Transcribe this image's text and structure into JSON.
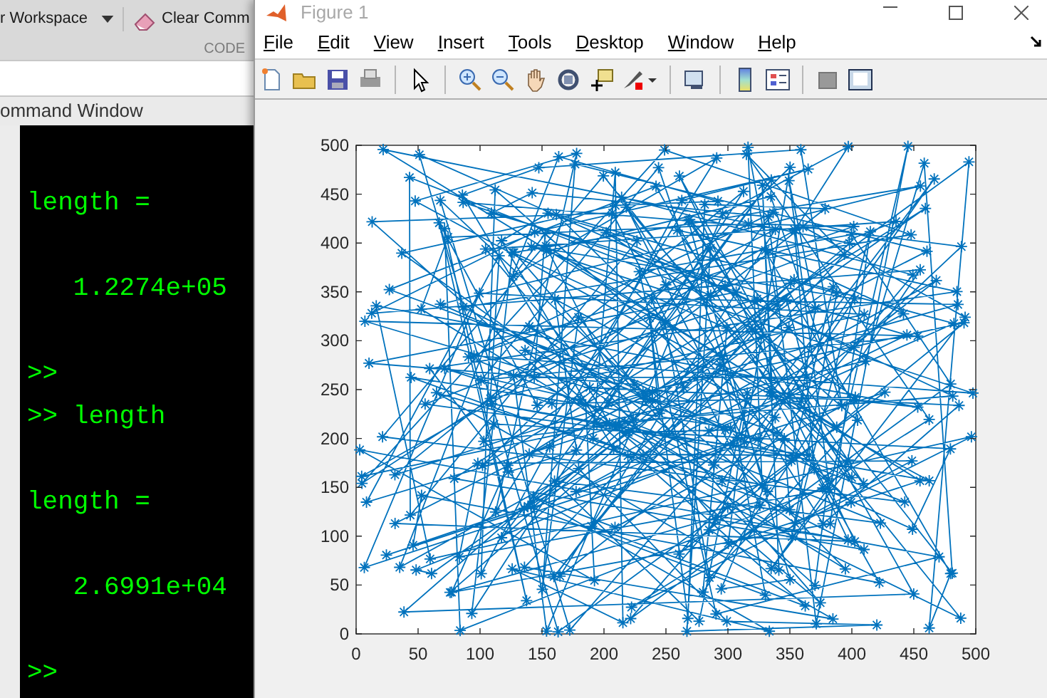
{
  "matlab": {
    "toolstrip": {
      "items": [
        {
          "label": "r Workspace",
          "kind": "dropdown"
        },
        {
          "label": "Clear Comm",
          "kind": "eraser"
        }
      ],
      "section_label": "CODE"
    },
    "command_window": {
      "title": "ommand Window",
      "lines": [
        {
          "text": "length =",
          "kind": "output"
        },
        {
          "text": "   1.2274e+05",
          "kind": "output"
        },
        {
          "text": ">>",
          "kind": "prompt"
        },
        {
          "text": ">> length",
          "kind": "prompt"
        },
        {
          "text": "length =",
          "kind": "output"
        },
        {
          "text": "   2.6991e+04",
          "kind": "output"
        },
        {
          "text": ">>",
          "kind": "prompt"
        }
      ]
    }
  },
  "figure": {
    "title": "Figure 1",
    "menu": [
      "File",
      "Edit",
      "View",
      "Insert",
      "Tools",
      "Desktop",
      "Window",
      "Help"
    ],
    "axes": {
      "x_tick_labels": [
        "0",
        "50",
        "100",
        "150",
        "200",
        "250",
        "300",
        "350",
        "400",
        "450",
        "500"
      ],
      "y_tick_labels": [
        "500",
        "450",
        "400",
        "350",
        "300",
        "250",
        "200",
        "150",
        "100",
        "50",
        "0"
      ]
    }
  }
}
